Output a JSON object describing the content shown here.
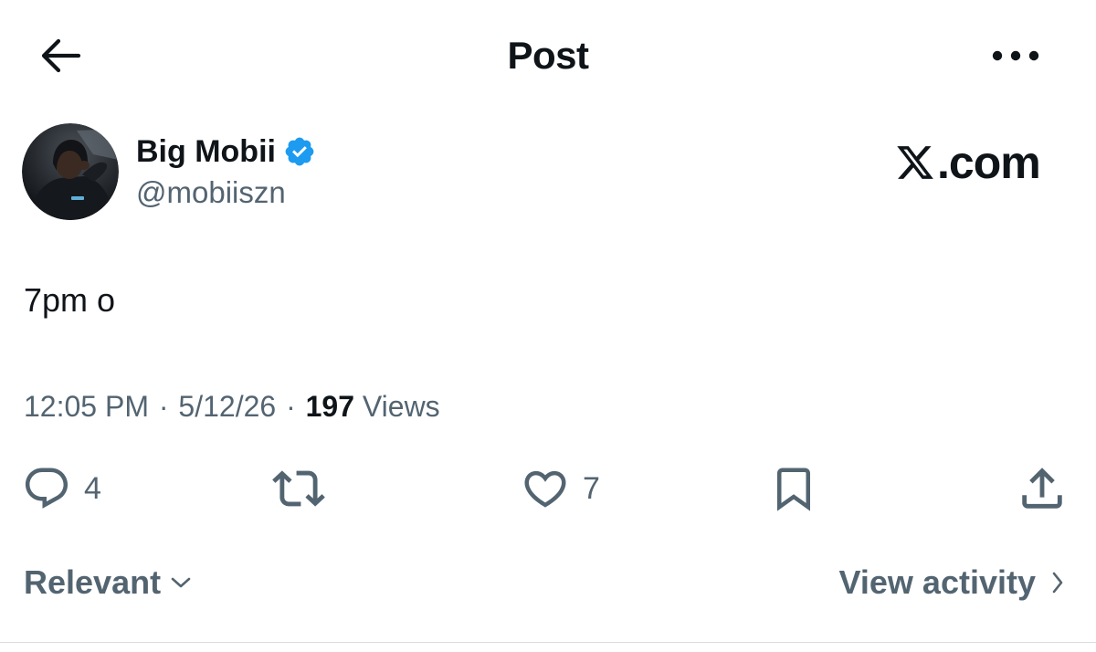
{
  "header": {
    "title": "Post",
    "back_icon": "arrow-left-icon",
    "more_icon": "more-horizontal-icon"
  },
  "author": {
    "display_name": "Big Mobii",
    "handle": "@mobiiszn",
    "verified": true,
    "verified_color": "#1d9bf0",
    "avatar_icon": "profile-photo"
  },
  "brand": {
    "logo_text": ".com",
    "logo_icon": "x-logo-icon"
  },
  "post": {
    "text": "7pm o"
  },
  "meta": {
    "time": "12:05 PM",
    "separator": "·",
    "date": "5/12/26",
    "views_count": "197",
    "views_label": " Views"
  },
  "actions": {
    "reply": {
      "icon": "reply-icon",
      "count": "4"
    },
    "repost": {
      "icon": "repost-icon",
      "count": ""
    },
    "like": {
      "icon": "heart-icon",
      "count": "7"
    },
    "bookmark": {
      "icon": "bookmark-icon"
    },
    "share": {
      "icon": "share-icon"
    }
  },
  "footer": {
    "sort_label": "Relevant",
    "sort_icon": "chevron-down-icon",
    "activity_label": "View activity",
    "activity_icon": "chevron-right-icon"
  },
  "colors": {
    "text_primary": "#0f1419",
    "text_secondary": "#536471",
    "background": "#ffffff"
  }
}
